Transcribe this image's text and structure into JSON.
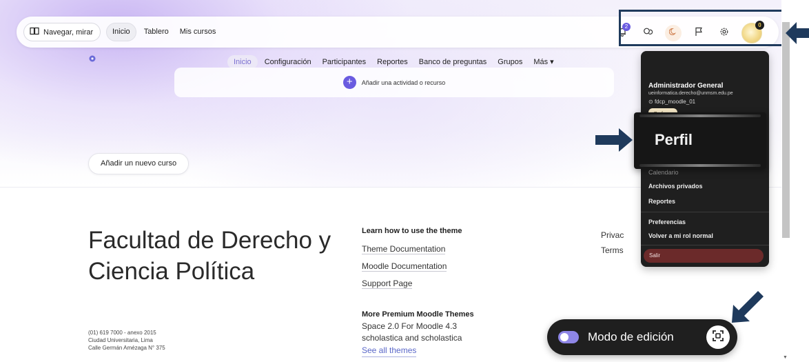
{
  "navbar": {
    "drawer_label": "Navegar, mirar",
    "links": [
      "Inicio",
      "Tablero",
      "Mis cursos"
    ],
    "notifications_count": "2",
    "avatar_badge": "0"
  },
  "secondary_nav": {
    "items": [
      "Inicio",
      "Configuración",
      "Participantes",
      "Reportes",
      "Banco de preguntas",
      "Grupos",
      "Más ▾"
    ]
  },
  "activity": {
    "label": "Añadir una actividad o recurso"
  },
  "new_course_label": "Añadir un nuevo curso",
  "user_menu": {
    "name": "Administrador General",
    "email": "ueinformatica.derecho@unmsm.edu.pe",
    "username": "fdcp_moodle_01",
    "role": "Profesor",
    "items": [
      "Calendario",
      "Archivos privados",
      "Reportes",
      "Preferencias",
      "Volver a mi rol normal"
    ],
    "logout": "Salir",
    "profile_zoom": "Perfil"
  },
  "footer": {
    "title": "Facultad de Derecho y Ciencia Política",
    "address_lines": [
      "(01) 619 7000 - anexo 2015",
      "Ciudad Universitaria, Lima",
      "Calle Germán Amézaga N° 375"
    ],
    "learn_heading": "Learn how to use the theme",
    "learn_links": [
      "Theme Documentation",
      "Moodle Documentation",
      "Support Page"
    ],
    "premium_heading": "More Premium Moodle Themes",
    "premium_lines": [
      "Space 2.0 For Moodle 4.3",
      "scholastica and scholastica"
    ],
    "see_all": "See all themes",
    "right_links": [
      "Privac",
      "Terms"
    ]
  },
  "edit_mode": {
    "label": "Modo de edición",
    "enabled": true
  },
  "colors": {
    "accent": "#6a5be0",
    "annotation": "#1f3a5c",
    "dark_panel": "#1f1f1f"
  }
}
